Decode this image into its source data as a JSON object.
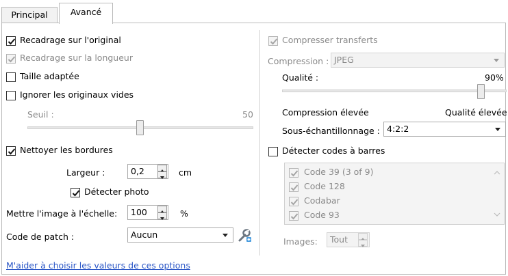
{
  "tabs": [
    {
      "label": "Principal",
      "active": false
    },
    {
      "label": "Avancé",
      "active": true
    }
  ],
  "left": {
    "recadrage_original": {
      "label": "Recadrage sur l'original",
      "checked": true,
      "enabled": true
    },
    "recadrage_longueur": {
      "label": "Recadrage sur la longueur",
      "checked": true,
      "enabled": false
    },
    "taille_adaptee": {
      "label": "Taille adaptée",
      "checked": false,
      "enabled": true
    },
    "ignorer_vides": {
      "label": "Ignorer les originaux vides",
      "checked": false,
      "enabled": true
    },
    "seuil": {
      "label": "Seuil :",
      "value": "50",
      "level": 0.5
    },
    "nettoyer_bordures": {
      "label": "Nettoyer les bordures",
      "checked": true,
      "enabled": true
    },
    "largeur": {
      "label": "Largeur :",
      "value": "0,2",
      "unit": "cm"
    },
    "detecter_photo": {
      "label": "Détecter photo",
      "checked": true
    },
    "echelle": {
      "label": "Mettre l'image à l'échelle:",
      "value": "100",
      "unit": "%"
    },
    "code_patch": {
      "label": "Code de patch :",
      "value": "Aucun"
    },
    "help_link": "M'aider à choisir les valeurs de ces options"
  },
  "right": {
    "compresser": {
      "label": "Compresser transferts",
      "checked": true,
      "enabled": false
    },
    "compression": {
      "label": "Compression :",
      "value": "JPEG"
    },
    "qualite": {
      "label": "Qualité :",
      "value": "90%",
      "level": 0.9
    },
    "compression_elevee": "Compression élevée",
    "qualite_elevee": "Qualité élevée",
    "sous_echantillonnage": {
      "label": "Sous-échantillonnage :",
      "value": "4:2:2"
    },
    "detecter_codes": {
      "label": "Détecter codes à barres",
      "checked": false
    },
    "barcodes": [
      {
        "label": "Code 39 (3 of 9)",
        "checked": true
      },
      {
        "label": "Code 128",
        "checked": true
      },
      {
        "label": "Codabar",
        "checked": true
      },
      {
        "label": "Code 93",
        "checked": true
      }
    ],
    "images": {
      "label": "Images:",
      "value": "Tout"
    }
  },
  "colors": {
    "link": "#2a56c6",
    "disabled_text": "#8a8a8a"
  },
  "icons": {
    "patch_settings": "wrench-plus-icon"
  }
}
